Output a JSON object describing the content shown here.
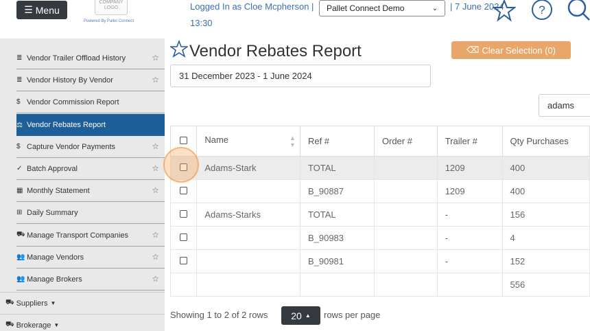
{
  "header": {
    "menu_label": "Menu",
    "logo_text": "COMPANY LOGO",
    "powered_by": "Powered By Pallet Connect",
    "logged_in": "Logged In as Cloe Mcpherson",
    "separator": "|",
    "time": "13:30",
    "company_selected": "Pallet Connect Demo",
    "date": "| 7 June 2024",
    "icons": [
      "star-icon",
      "help-icon",
      "search-icon"
    ]
  },
  "sidebar": {
    "items": [
      {
        "icon": "list-icon",
        "label": "Vendor Trailer Offload History",
        "star": true
      },
      {
        "icon": "list-icon",
        "label": "Vendor History By Vendor",
        "star": true
      },
      {
        "icon": "dollar-icon",
        "label": "Vendor Commission Report",
        "star": false
      },
      {
        "icon": "scale-icon",
        "label": "Vendor Rebates Report",
        "star": false,
        "active": true
      },
      {
        "icon": "dollar-icon",
        "label": "Capture Vendor Payments",
        "star": true
      },
      {
        "icon": "check-icon",
        "label": "Batch Approval",
        "star": true
      },
      {
        "icon": "calendar-icon",
        "label": "Monthly Statement",
        "star": true
      },
      {
        "icon": "table-icon",
        "label": "Daily Summary",
        "star": false
      },
      {
        "icon": "truck-icon",
        "label": "Manage Transport Companies",
        "star": true
      },
      {
        "icon": "users-icon",
        "label": "Manage Vendors",
        "star": true
      },
      {
        "icon": "users-icon",
        "label": "Manage Brokers",
        "star": true
      }
    ],
    "groups": [
      {
        "label": "Suppliers"
      },
      {
        "label": "Brokerage"
      }
    ]
  },
  "main": {
    "title": "Vendor Rebates Report",
    "clear_selection": "Clear Selection (0)",
    "date_range": "31 December 2023 - 1 June 2024",
    "search_value": "adams",
    "columns": [
      "Name",
      "Ref #",
      "Order #",
      "Trailer #",
      "Qty Purchases"
    ],
    "rows": [
      {
        "name": "Adams-Stark",
        "ref": "TOTAL",
        "order": "",
        "trailer": "1209",
        "qty": "400",
        "highlight": true
      },
      {
        "name": "",
        "ref": "B_90887",
        "order": "",
        "trailer": "1209",
        "qty": "400"
      },
      {
        "name": "Adams-Starks",
        "ref": "TOTAL",
        "order": "",
        "trailer": "-",
        "qty": "156"
      },
      {
        "name": "",
        "ref": "B_90983",
        "order": "",
        "trailer": "-",
        "qty": "4"
      },
      {
        "name": "",
        "ref": "B_90981",
        "order": "",
        "trailer": "-",
        "qty": "152"
      }
    ],
    "total_qty": "556",
    "footer_showing": "Showing 1 to 2 of 2 rows",
    "per_page": "20",
    "per_page_suffix": "rows per page"
  },
  "colors": {
    "accent": "#1f5f99",
    "clear_button": "#e9a66a",
    "dark_button": "#343a40",
    "link": "#3a6fb5"
  }
}
